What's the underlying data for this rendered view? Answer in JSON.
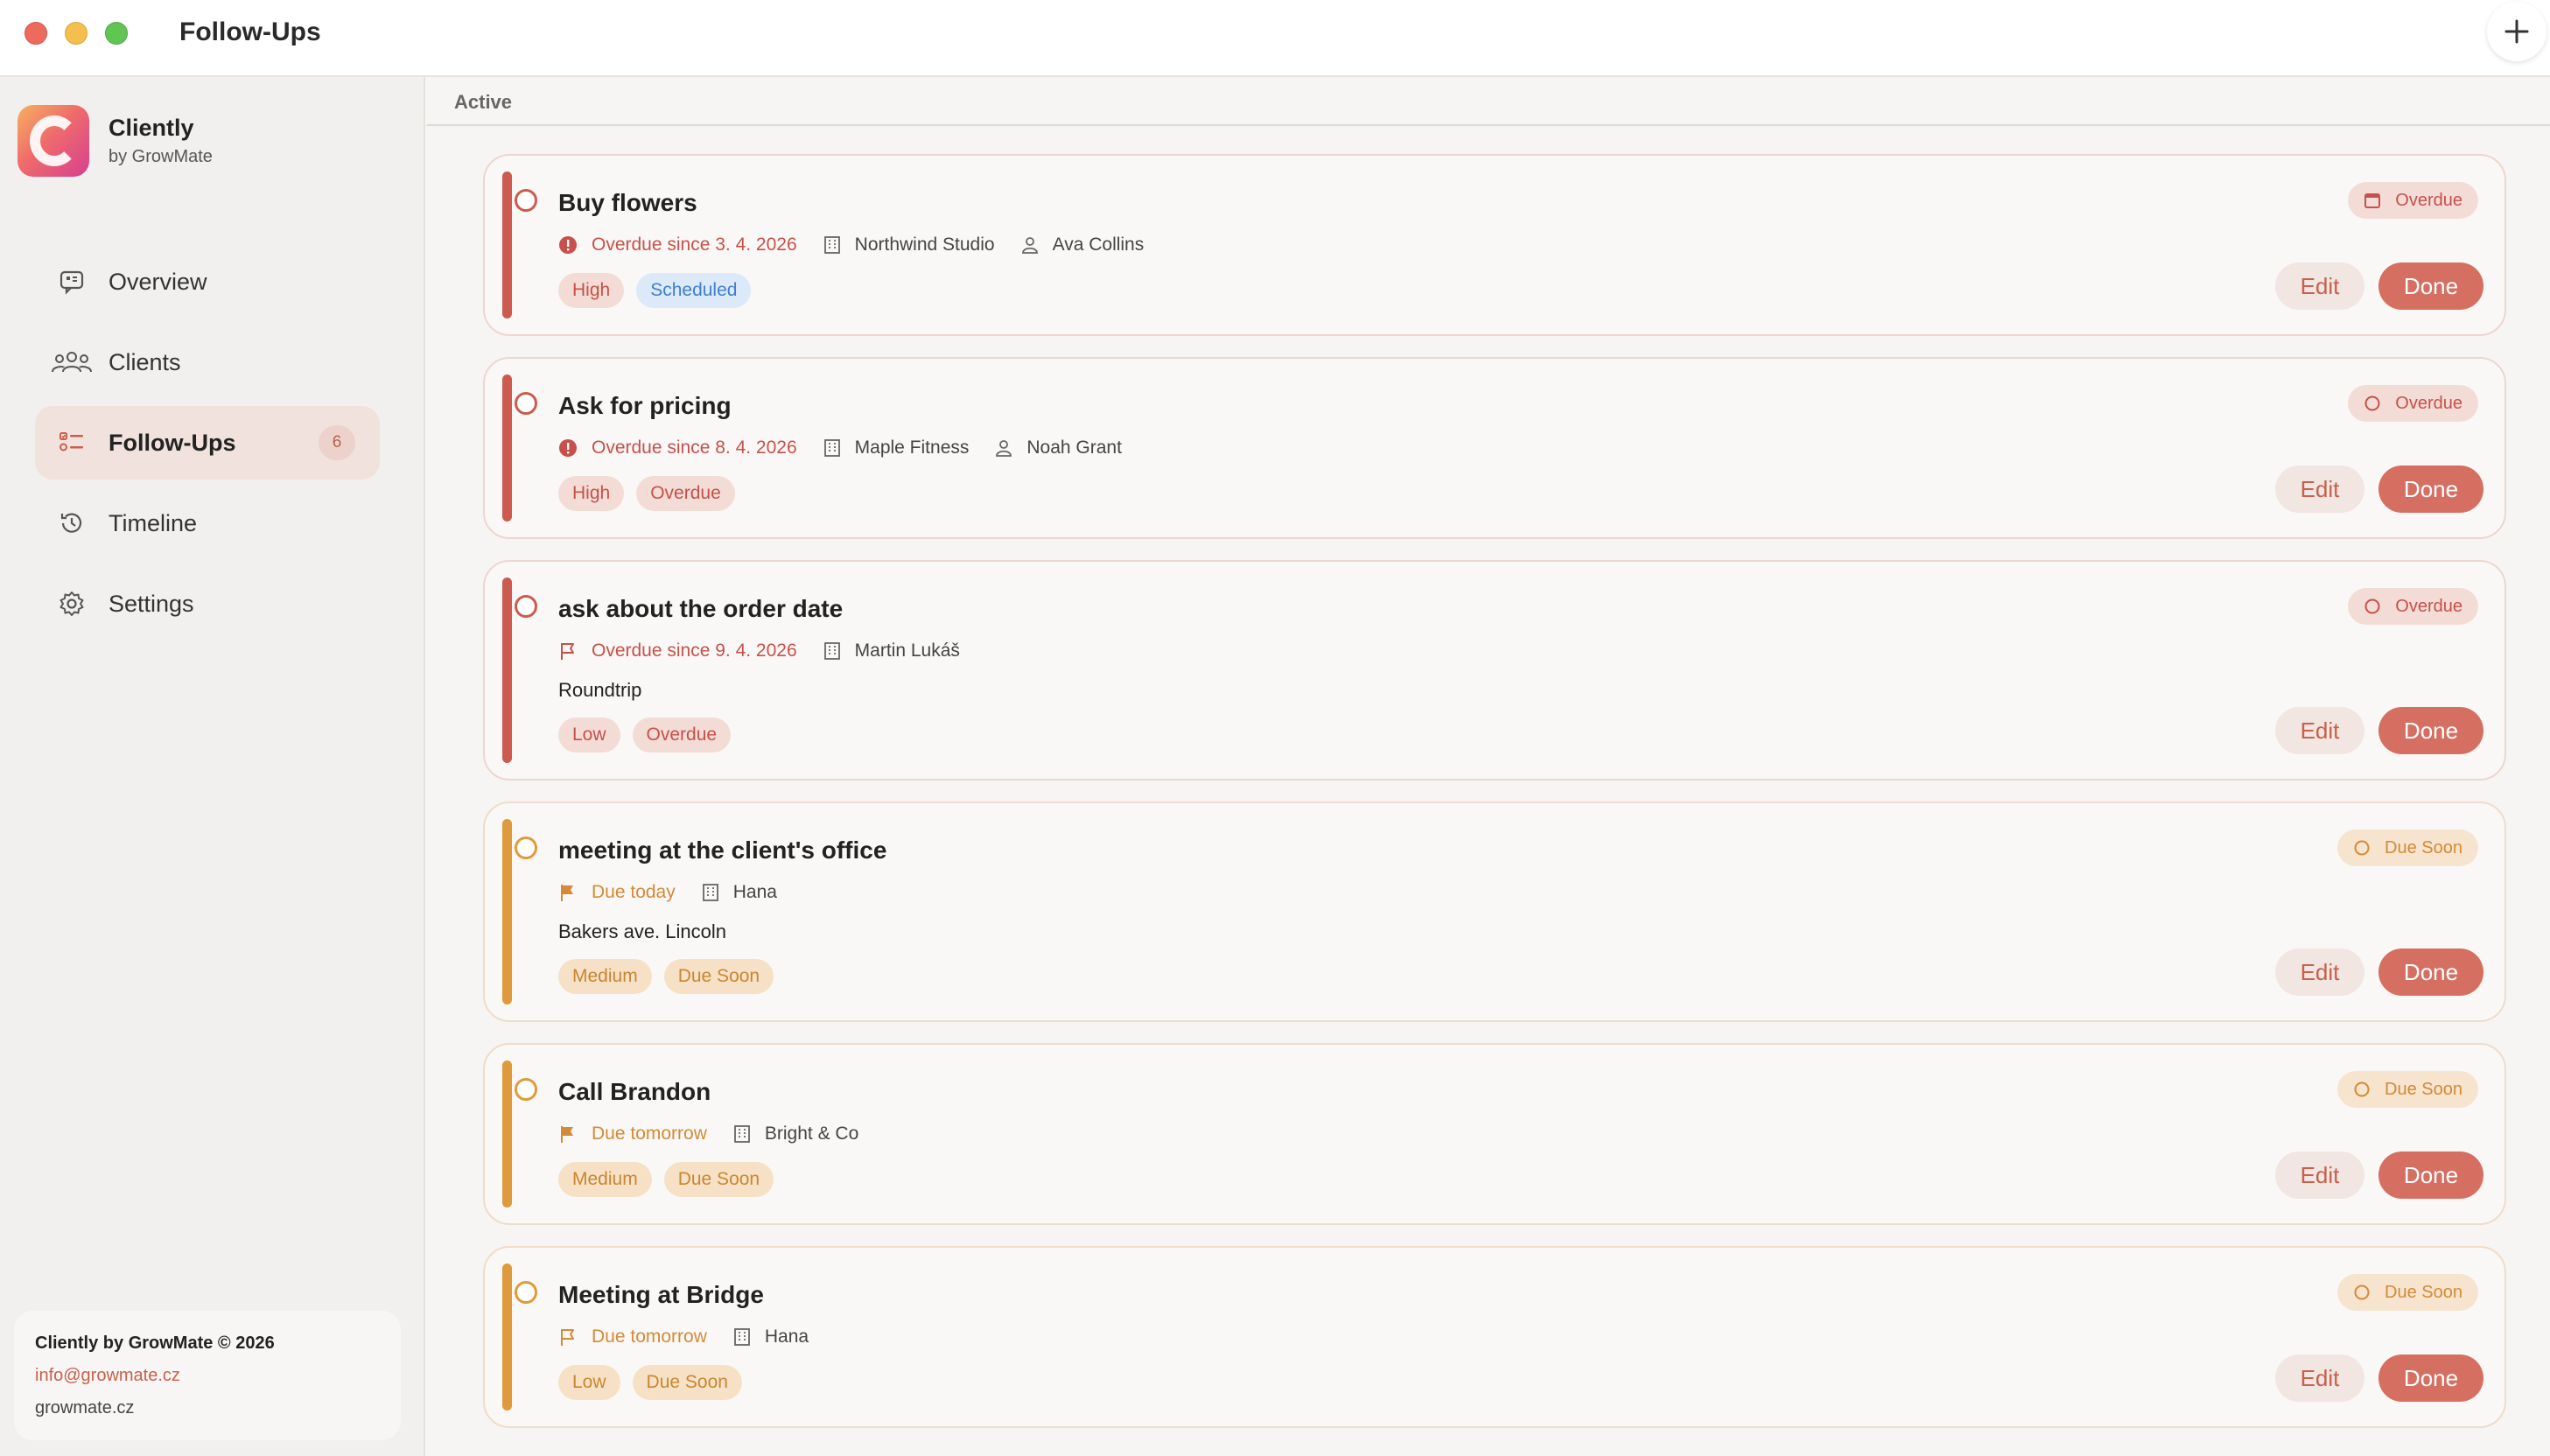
{
  "window": {
    "title": "Follow-Ups"
  },
  "brand": {
    "name": "Cliently",
    "sub": "by GrowMate"
  },
  "nav": [
    {
      "label": "Overview",
      "icon": "chat-icon"
    },
    {
      "label": "Clients",
      "icon": "users-icon"
    },
    {
      "label": "Follow-Ups",
      "icon": "list-icon",
      "badge": "6",
      "active": true
    },
    {
      "label": "Timeline",
      "icon": "history-icon"
    },
    {
      "label": "Settings",
      "icon": "gear-icon"
    }
  ],
  "footer": {
    "copyright": "Cliently by GrowMate © 2026",
    "email": "info@growmate.cz",
    "site": "growmate.cz"
  },
  "section": {
    "title": "Active"
  },
  "actions": {
    "edit": "Edit",
    "done": "Done"
  },
  "colors": {
    "overdue": "#cc5a4f",
    "due_soon": "#df9a3b",
    "accent": "#d46f62"
  },
  "cards": [
    {
      "title": "Buy flowers",
      "status": "Overdue",
      "status_icon": "calendar-icon",
      "due": "Overdue since 3. 4. 2026",
      "due_icon": "alert-icon",
      "company": "Northwind Studio",
      "person": "Ava Collins",
      "tags": [
        "High",
        "Scheduled"
      ]
    },
    {
      "title": "Ask for pricing",
      "status": "Overdue",
      "status_icon": "circle-icon",
      "due": "Overdue since 8. 4. 2026",
      "due_icon": "alert-icon",
      "company": "Maple Fitness",
      "person": "Noah Grant",
      "tags": [
        "High",
        "Overdue"
      ]
    },
    {
      "title": "ask about the order date",
      "status": "Overdue",
      "status_icon": "circle-icon",
      "due": "Overdue since 9. 4. 2026",
      "due_icon": "flag-outline-icon",
      "company": "Martin Lukáš",
      "note": "Roundtrip",
      "tags": [
        "Low",
        "Overdue"
      ]
    },
    {
      "title": "meeting at the client's office",
      "status": "Due Soon",
      "status_icon": "circle-icon",
      "due": "Due today",
      "due_icon": "flag-filled-icon",
      "company": "Hana",
      "note": "Bakers ave. Lincoln",
      "tags": [
        "Medium",
        "Due Soon"
      ]
    },
    {
      "title": "Call Brandon",
      "status": "Due Soon",
      "status_icon": "circle-icon",
      "due": "Due tomorrow",
      "due_icon": "flag-filled-icon",
      "company": "Bright & Co",
      "tags": [
        "Medium",
        "Due Soon"
      ]
    },
    {
      "title": "Meeting at Bridge",
      "status": "Due Soon",
      "status_icon": "circle-icon",
      "due": "Due tomorrow",
      "due_icon": "flag-outline-icon",
      "company": "Hana",
      "tags": [
        "Low",
        "Due Soon"
      ]
    }
  ]
}
